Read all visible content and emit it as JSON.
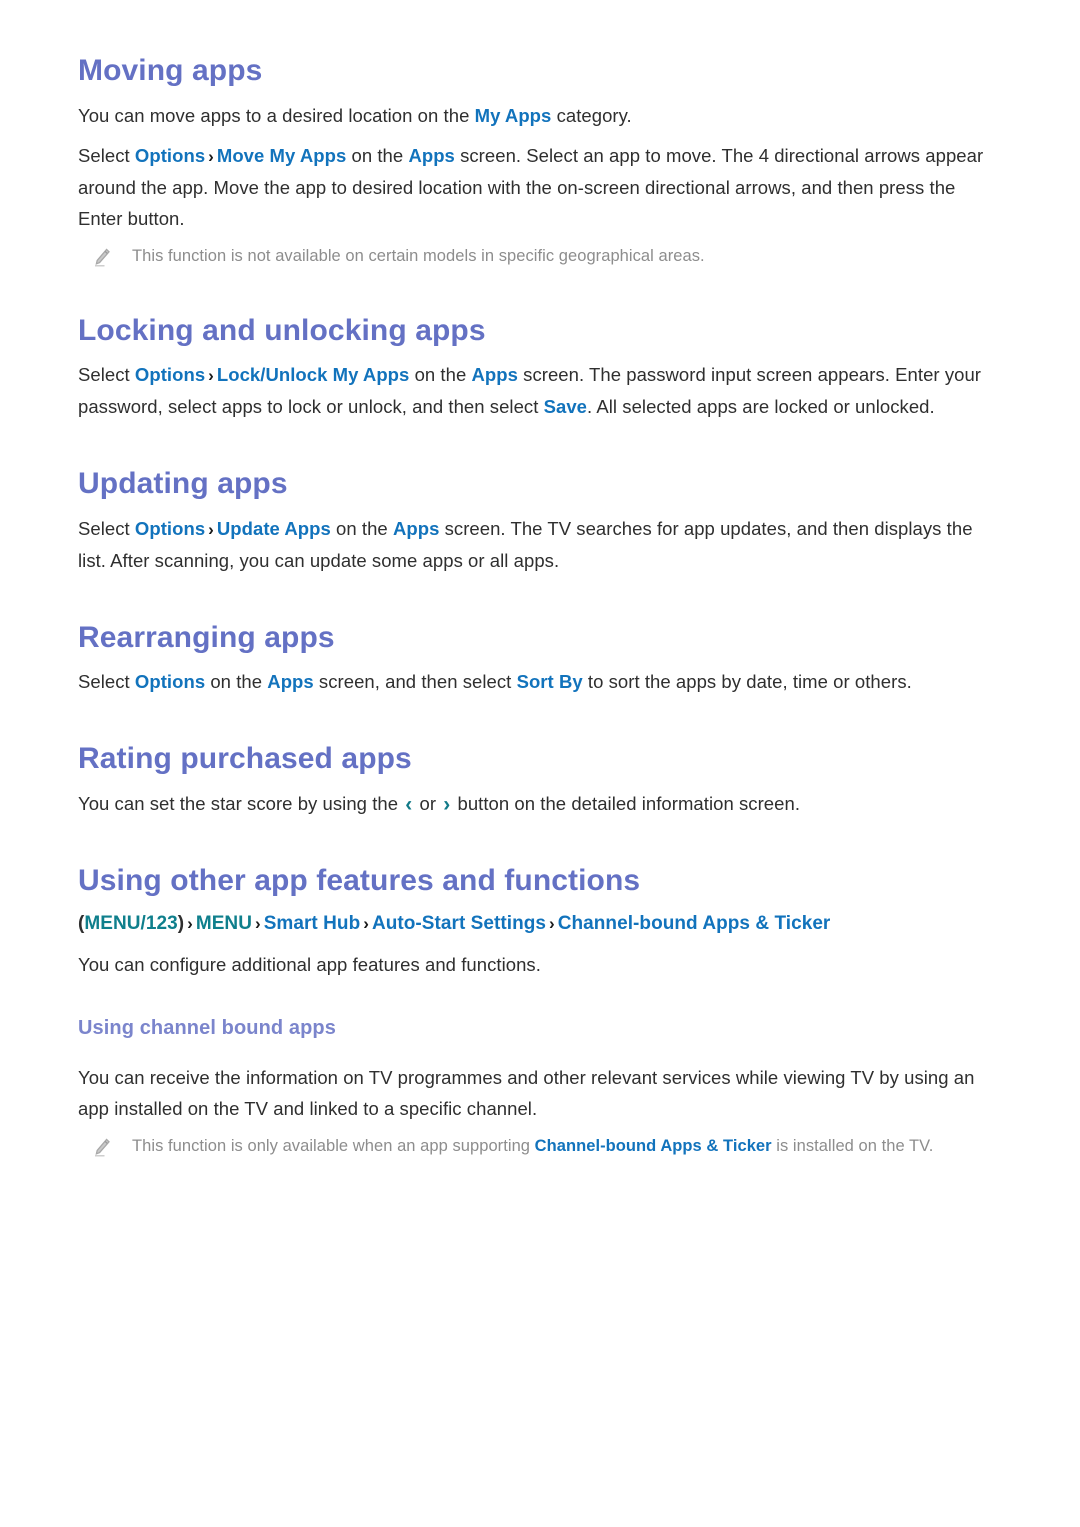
{
  "document": {
    "type": "tv-e-manual-page",
    "colors": {
      "heading": "#6471c4",
      "subheading": "#7b85cc",
      "link": "#1273bc",
      "remote_key": "#0f7f8c",
      "body": "#2f2f2f",
      "note": "#8d8d8d",
      "background": "#ffffff"
    }
  },
  "sections": {
    "moving_apps": {
      "title": "Moving apps",
      "p1": {
        "a": "You can move apps to a desired location on the ",
        "link1": "My Apps",
        "b": " category."
      },
      "p2": {
        "a": "Select ",
        "link1": "Options",
        "sep": "›",
        "link2": "Move My Apps",
        "b": " on the ",
        "link3": "Apps",
        "c": " screen. Select an app to move. The 4 directional arrows appear around the app. Move the app to desired location with the on-screen directional arrows, and then press the Enter button."
      },
      "note": {
        "icon": "pencil-icon",
        "text": "This function is not available on certain models in specific geographical areas."
      }
    },
    "locking_apps": {
      "title": "Locking and unlocking apps",
      "p1": {
        "a": "Select ",
        "link1": "Options",
        "sep": "›",
        "link2": "Lock/Unlock My Apps",
        "b": " on the ",
        "link3": "Apps",
        "c": " screen. The password input screen appears. Enter your password, select apps to lock or unlock, and then select ",
        "link4": "Save",
        "d": ". All selected apps are locked or unlocked."
      }
    },
    "updating_apps": {
      "title": "Updating apps",
      "p1": {
        "a": "Select ",
        "link1": "Options",
        "sep": "›",
        "link2": "Update Apps",
        "b": " on the ",
        "link3": "Apps",
        "c": " screen. The TV searches for app updates, and then displays the list. After scanning, you can update some apps or all apps."
      }
    },
    "rearranging_apps": {
      "title": "Rearranging apps",
      "p1": {
        "a": "Select ",
        "link1": "Options",
        "b": " on the ",
        "link2": "Apps",
        "c": " screen, and then select ",
        "link3": "Sort By",
        "d": " to sort the apps by date, time or others."
      }
    },
    "rating_apps": {
      "title": "Rating purchased apps",
      "p1": {
        "a": "You can set the star score by using the ",
        "left_chevron": "‹",
        "b": " or ",
        "right_chevron": "›",
        "c": " button on the detailed information screen."
      }
    },
    "other_features": {
      "title": "Using other app features and functions",
      "breadcrumb": {
        "open_paren": "(",
        "item0": "MENU/123",
        "close_paren": ")",
        "sep": "›",
        "item1": "MENU",
        "item2": "Smart Hub",
        "item3": "Auto-Start Settings",
        "item4": "Channel-bound Apps & Ticker"
      },
      "p1": "You can configure additional app features and functions.",
      "subsection": {
        "title": "Using channel bound apps",
        "p1": "You can receive the information on TV programmes and other relevant services while viewing TV by using an app installed on the TV and linked to a specific channel.",
        "note": {
          "icon": "pencil-icon",
          "a": "This function is only available when an app supporting ",
          "link1": "Channel-bound Apps & Ticker",
          "b": " is installed on the TV."
        }
      }
    }
  }
}
